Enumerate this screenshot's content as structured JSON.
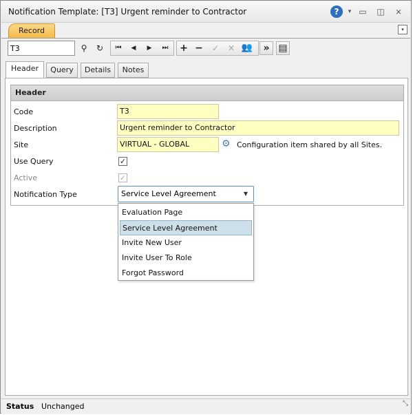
{
  "window": {
    "title": "Notification Template: [T3] Urgent reminder to Contractor",
    "help_icon": "question-circle-icon",
    "help_glyph": "?",
    "dropdown_glyph": "▾",
    "minimize_glyph": "▭",
    "restore_glyph": "◫",
    "close_glyph": "⨯"
  },
  "record_tab": {
    "label": "Record"
  },
  "strip_menu_glyph": "▾",
  "toolbar": {
    "search_value": "T3",
    "icons": {
      "search": "⚲",
      "refresh": "↻",
      "first": "⏮",
      "prev": "◀",
      "next": "▶",
      "last": "⏭",
      "add": "+",
      "remove": "−",
      "accept": "✓",
      "cancel": "✕",
      "users": "👥",
      "more": "»",
      "page": "▤"
    }
  },
  "tabs": [
    {
      "label": "Header"
    },
    {
      "label": "Query"
    },
    {
      "label": "Details"
    },
    {
      "label": "Notes"
    }
  ],
  "header_section": {
    "title": "Header",
    "fields": {
      "code": {
        "label": "Code",
        "value": "T3"
      },
      "description": {
        "label": "Description",
        "value": "Urgent reminder to Contractor"
      },
      "site": {
        "label": "Site",
        "value": "VIRTUAL - GLOBAL",
        "note": "Configuration item shared by all Sites.",
        "icon_glyph": "⚙"
      },
      "use_query": {
        "label": "Use Query",
        "checked_glyph": "✓"
      },
      "active": {
        "label": "Active",
        "checked_glyph": "✓"
      },
      "notification_type": {
        "label": "Notification Type",
        "value": "Service Level Agreement",
        "arrow": "▼"
      }
    }
  },
  "notification_type_options": [
    "Evaluation Page",
    "Service Level Agreement",
    "Invite New User",
    "Invite User To Role",
    "Forgot Password"
  ],
  "status": {
    "label": "Status",
    "value": "Unchanged",
    "grip_glyph": "⤡"
  }
}
